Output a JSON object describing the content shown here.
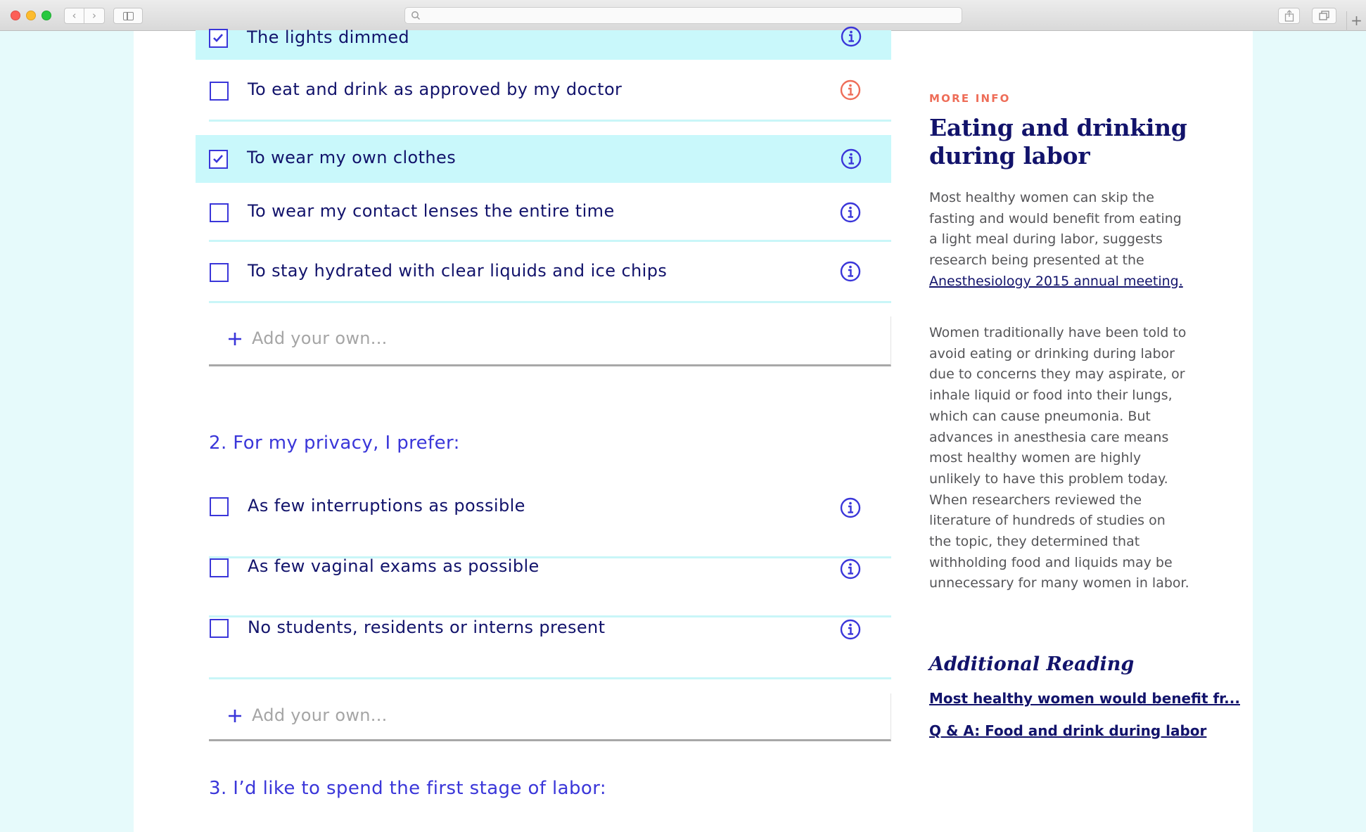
{
  "browser": {
    "back_glyph": "‹",
    "forward_glyph": "›",
    "new_tab_glyph": "+"
  },
  "section1": {
    "items": [
      {
        "label": "The lights dimmed",
        "checked": true,
        "info_icon": "info-circle-icon"
      },
      {
        "label": "To eat and drink as approved by my doctor",
        "checked": false,
        "info_icon": "info-circle-icon",
        "info_active": true
      },
      {
        "label": "To wear my own clothes",
        "checked": true,
        "info_icon": "info-circle-icon"
      },
      {
        "label": "To wear my contact lenses the entire time",
        "checked": false,
        "info_icon": "info-circle-icon"
      },
      {
        "label": "To stay hydrated with clear liquids and ice chips",
        "checked": false,
        "info_icon": "info-circle-icon"
      }
    ],
    "add_placeholder": "Add your own..."
  },
  "section2": {
    "heading": "2. For my privacy, I prefer:",
    "items": [
      {
        "label": "As few interruptions as possible",
        "checked": false
      },
      {
        "label": "As few vaginal exams as possible",
        "checked": false
      },
      {
        "label": "No students, residents or interns present",
        "checked": false
      }
    ],
    "add_placeholder": "Add your own..."
  },
  "section3": {
    "heading": "3. I’d like to spend the first stage of labor:"
  },
  "side": {
    "eyebrow": "MORE INFO",
    "title": "Eating and drinking during labor",
    "para1_text": "Most healthy women can skip the fasting and would benefit from eating a light meal during labor, suggests research being presented at the ",
    "para1_link": "Anesthesiology 2015 annual meeting.",
    "para2": "Women traditionally have been told to avoid eating or drinking during labor due to concerns they may aspirate, or inhale liquid or food into their lungs, which can cause pneumonia. But advances in anesthesia care means most healthy women are highly unlikely to have this problem today. When researchers reviewed the literature of hundreds of studies on the topic, they determined that withholding food and liquids may be unnecessary for many women in labor.",
    "additional_heading": "Additional Reading",
    "links": [
      "Most healthy women would benefit fr...",
      "Q & A: Food and drink during labor"
    ]
  },
  "colors": {
    "accent": "#3a36d9",
    "navy": "#12136b",
    "checked_bg": "#c9f8fb",
    "info_active": "#ee6d58",
    "page_bg": "#e6fafb"
  }
}
